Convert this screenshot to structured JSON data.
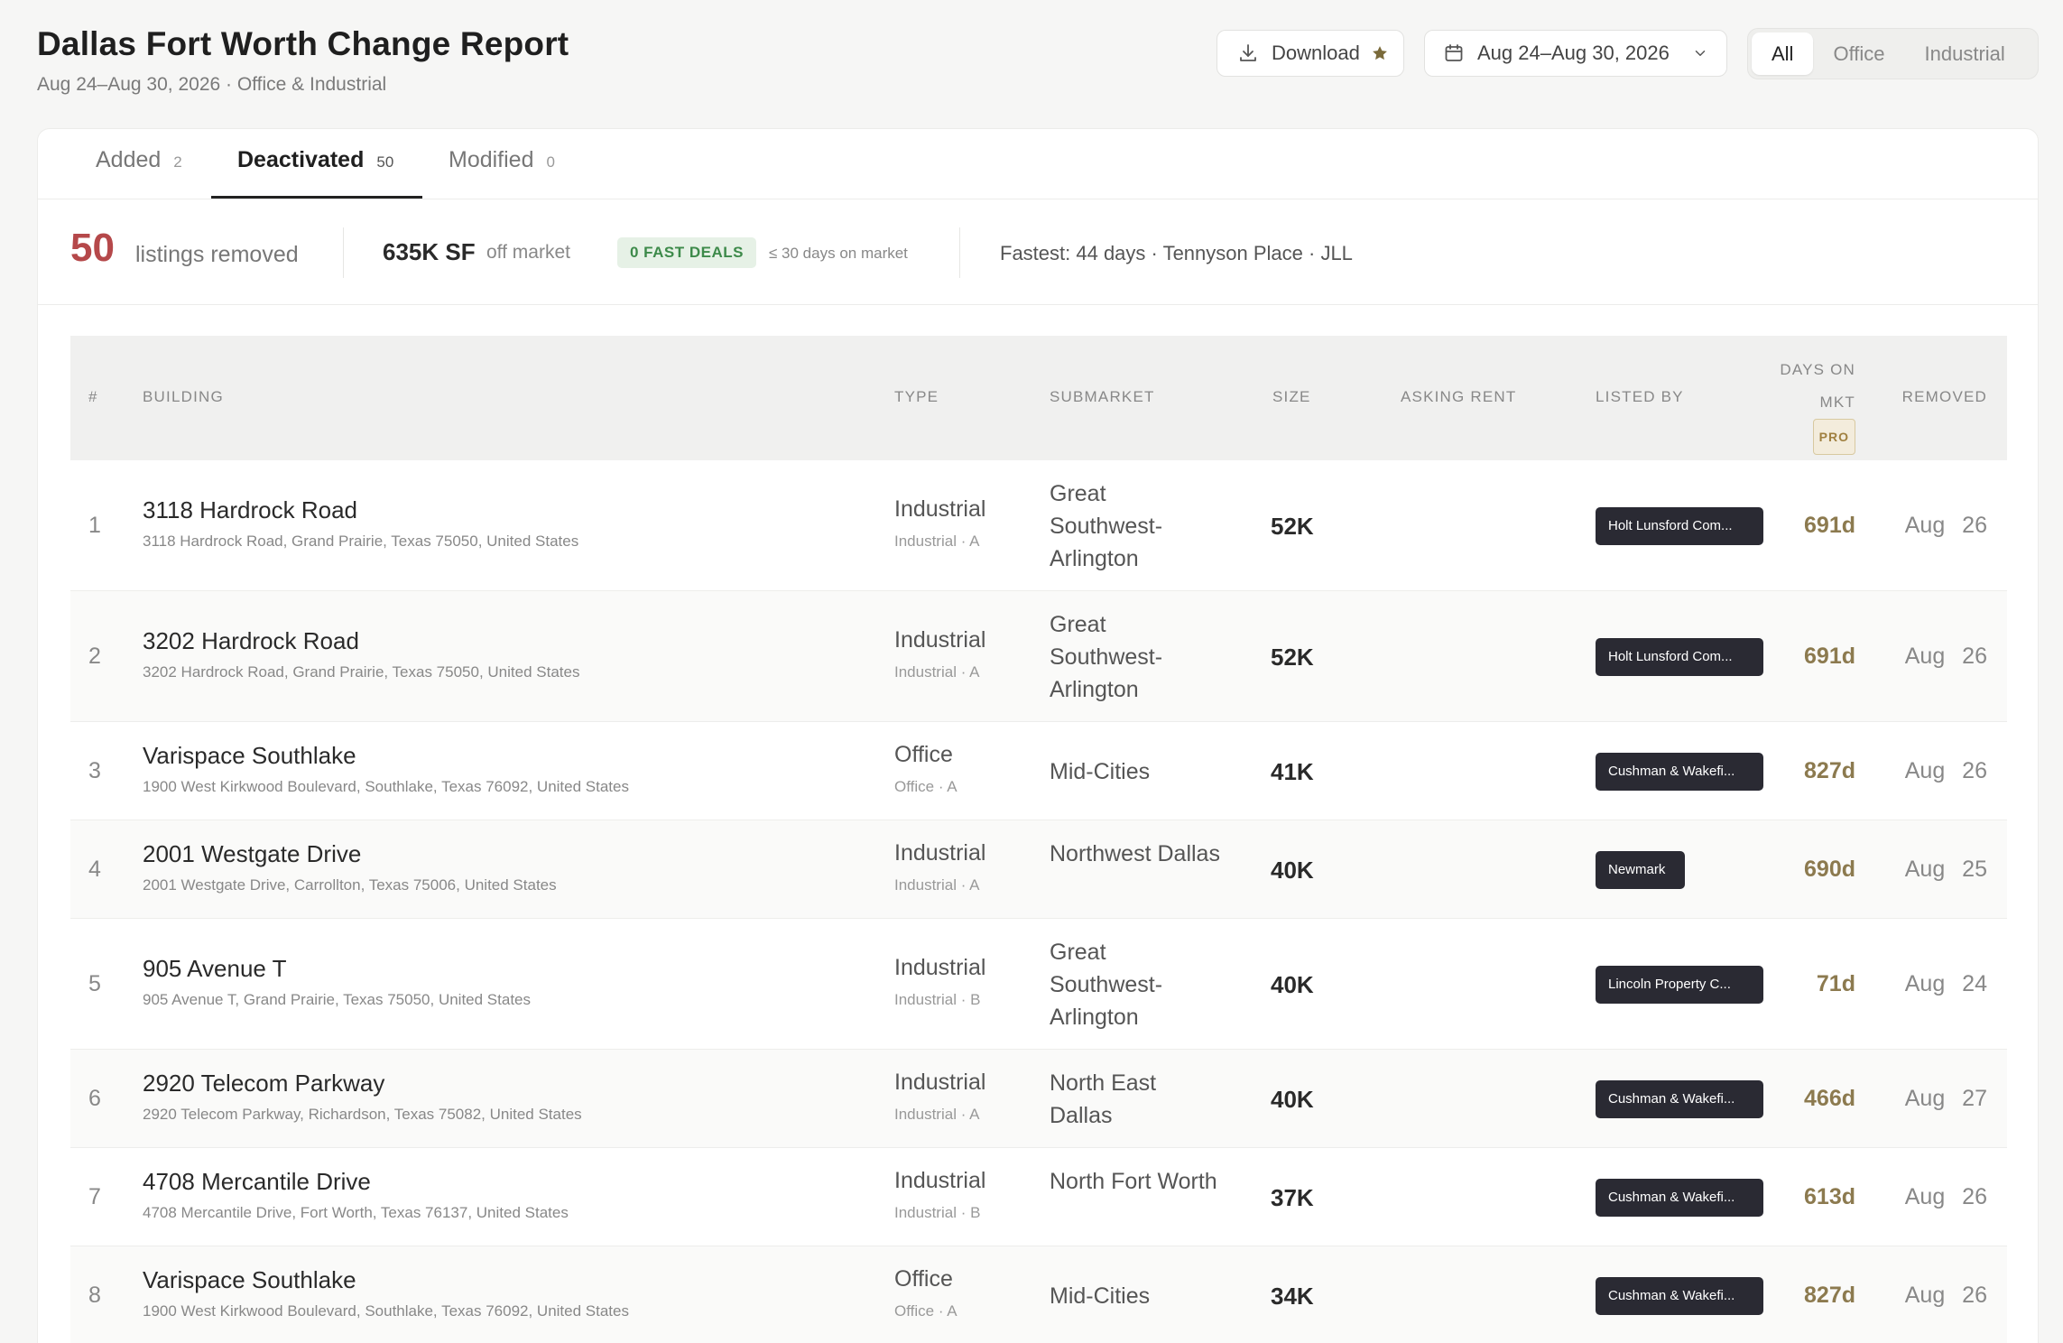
{
  "header": {
    "title": "Dallas Fort Worth Change Report",
    "subtitle": "Aug 24–Aug 30, 2026 · Office & Industrial",
    "download_label": "Download",
    "date_range": "Aug 24–Aug 30, 2026",
    "filters": [
      "All",
      "Office",
      "Industrial"
    ],
    "active_filter": "All"
  },
  "tabs": [
    {
      "label": "Added",
      "count": "2"
    },
    {
      "label": "Deactivated",
      "count": "50"
    },
    {
      "label": "Modified",
      "count": "0"
    }
  ],
  "stats": {
    "removed_count": "50",
    "removed_label": "listings removed",
    "sf": "635K SF",
    "sf_label": "off market",
    "fast_deals": "0 FAST DEALS",
    "fast_note": "≤ 30 days on market",
    "fastest": "Fastest: 44 days · Tennyson Place · JLL"
  },
  "columns": {
    "num": "#",
    "building": "BUILDING",
    "type": "TYPE",
    "submarket": "SUBMARKET",
    "size": "SIZE",
    "asking_rent": "ASKING RENT",
    "listed_by": "LISTED BY",
    "days_line1": "DAYS ON",
    "days_line2": "MKT",
    "days_badge": "PRO",
    "removed": "REMOVED"
  },
  "rows": [
    {
      "num": "1",
      "name": "3118 Hardrock Road",
      "address": "3118 Hardrock Road, Grand Prairie, Texas 75050, United States",
      "type": "Industrial",
      "type_sub": "Industrial · A",
      "submarket": "Great Southwest-Arlington",
      "size": "52K",
      "broker": "Holt Lunsford Com...",
      "days": "691d",
      "removed": "Aug 26"
    },
    {
      "num": "2",
      "name": "3202 Hardrock Road",
      "address": "3202 Hardrock Road, Grand Prairie, Texas 75050, United States",
      "type": "Industrial",
      "type_sub": "Industrial · A",
      "submarket": "Great Southwest-Arlington",
      "size": "52K",
      "broker": "Holt Lunsford Com...",
      "days": "691d",
      "removed": "Aug 26"
    },
    {
      "num": "3",
      "name": "Varispace Southlake",
      "address": "1900 West Kirkwood Boulevard, Southlake, Texas 76092, United States",
      "type": "Office",
      "type_sub": "Office · A",
      "submarket": "Mid-Cities",
      "size": "41K",
      "broker": "Cushman & Wakefi...",
      "days": "827d",
      "removed": "Aug 26"
    },
    {
      "num": "4",
      "name": "2001 Westgate Drive",
      "address": "2001 Westgate Drive, Carrollton, Texas 75006, United States",
      "type": "Industrial",
      "type_sub": "Industrial · A",
      "submarket": "Northwest Dallas",
      "size": "40K",
      "broker": "Newmark",
      "days": "690d",
      "removed": "Aug 25"
    },
    {
      "num": "5",
      "name": "905 Avenue T",
      "address": "905 Avenue T, Grand Prairie, Texas 75050, United States",
      "type": "Industrial",
      "type_sub": "Industrial · B",
      "submarket": "Great Southwest-Arlington",
      "size": "40K",
      "broker": "Lincoln Property C...",
      "days": "71d",
      "removed": "Aug 24"
    },
    {
      "num": "6",
      "name": "2920 Telecom Parkway",
      "address": "2920 Telecom Parkway, Richardson, Texas 75082, United States",
      "type": "Industrial",
      "type_sub": "Industrial · A",
      "submarket": "North East Dallas",
      "size": "40K",
      "broker": "Cushman & Wakefi...",
      "days": "466d",
      "removed": "Aug 27"
    },
    {
      "num": "7",
      "name": "4708 Mercantile Drive",
      "address": "4708 Mercantile Drive, Fort Worth, Texas 76137, United States",
      "type": "Industrial",
      "type_sub": "Industrial · B",
      "submarket": "North Fort Worth",
      "size": "37K",
      "broker": "Cushman & Wakefi...",
      "days": "613d",
      "removed": "Aug 26"
    },
    {
      "num": "8",
      "name": "Varispace Southlake",
      "address": "1900 West Kirkwood Boulevard, Southlake, Texas 76092, United States",
      "type": "Office",
      "type_sub": "Office · A",
      "submarket": "Mid-Cities",
      "size": "34K",
      "broker": "Cushman & Wakefi...",
      "days": "827d",
      "removed": "Aug 26"
    }
  ]
}
